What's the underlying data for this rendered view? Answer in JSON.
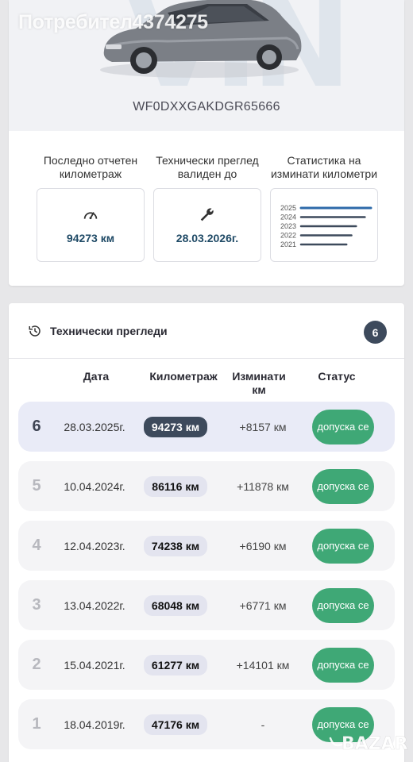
{
  "hero": {
    "username": "Потребител4374275",
    "watermark": "VIN",
    "vin": "WF0DXXGAKDGR65666"
  },
  "stats": {
    "mileage_label": "Последно отчетен километраж",
    "mileage_value": "94273 км",
    "mileage_icon": "speedometer-icon",
    "inspection_label": "Технически преглед валиден до",
    "inspection_value": "28.03.2026г.",
    "inspection_icon": "wrench-icon",
    "chart_label": "Статистика на изминати километри"
  },
  "chart_data": {
    "type": "bar",
    "orientation": "horizontal",
    "categories": [
      "2025",
      "2024",
      "2023",
      "2022",
      "2021"
    ],
    "series": [
      {
        "values": [
          94273,
          86116,
          74238,
          68048,
          61277
        ]
      }
    ],
    "colors": [
      "#2d6aa9",
      "#3d4a5c",
      "#3d4a5c",
      "#3d4a5c",
      "#3d4a5c"
    ],
    "xlim": [
      0,
      94273
    ],
    "grid": false,
    "title": "",
    "xlabel": "",
    "ylabel": ""
  },
  "inspections": {
    "title": "Технически прегледи",
    "icon": "history-icon",
    "count": "6",
    "headers": {
      "date": "Дата",
      "mileage": "Километраж",
      "diff": "Изминати км"
    },
    "header_status": "Статус",
    "rows": [
      {
        "num": "6",
        "date": "28.03.2025г.",
        "km": "94273 км",
        "diff": "+8157 км",
        "status": "допуска се"
      },
      {
        "num": "5",
        "date": "10.04.2024г.",
        "km": "86116 км",
        "diff": "+11878 км",
        "status": "допуска се"
      },
      {
        "num": "4",
        "date": "12.04.2023г.",
        "km": "74238 км",
        "diff": "+6190 км",
        "status": "допуска се"
      },
      {
        "num": "3",
        "date": "13.04.2022г.",
        "km": "68048 км",
        "diff": "+6771 км",
        "status": "допуска се"
      },
      {
        "num": "2",
        "date": "15.04.2021г.",
        "km": "61277 км",
        "diff": "+14101 км",
        "status": "допуска се"
      },
      {
        "num": "1",
        "date": "18.04.2019г.",
        "km": "47176 км",
        "diff": "-",
        "status": "допуска се"
      }
    ]
  },
  "watermark_logo": "BAZAR"
}
